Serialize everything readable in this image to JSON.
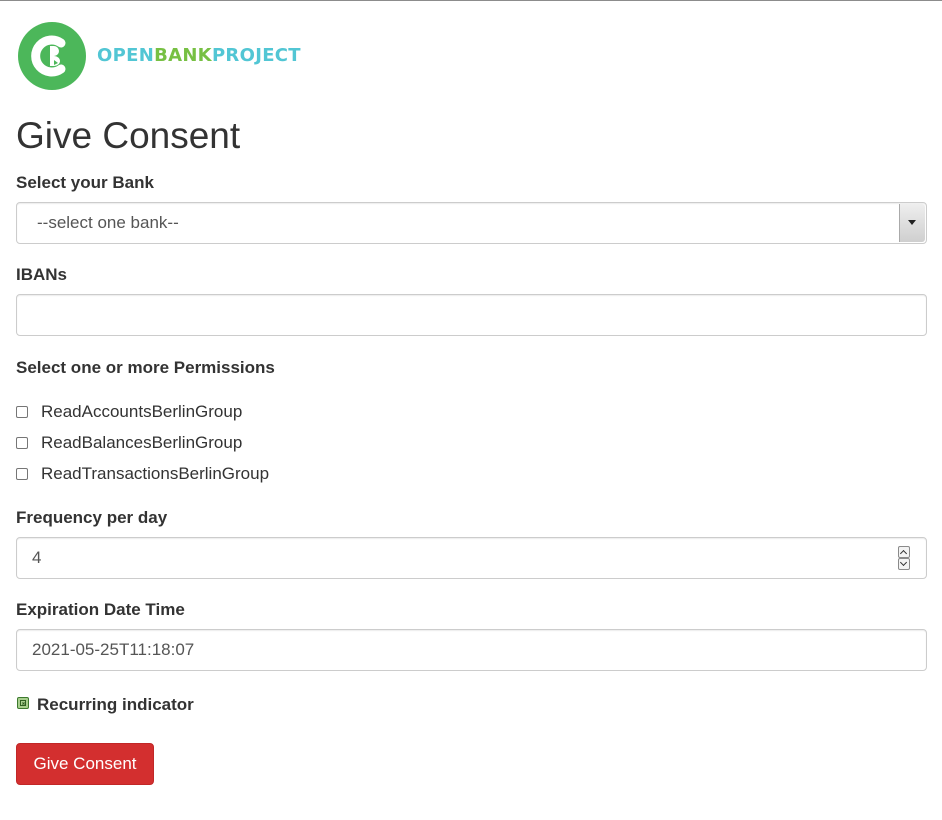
{
  "logo": {
    "icon": "open-bank-project-logo",
    "brand_part1": "OPEN",
    "brand_part2": "BANK",
    "brand_part3": "PROJECT",
    "colors": {
      "green": "#4cb75a",
      "teal": "#52c6d4",
      "lime": "#77c043"
    }
  },
  "page": {
    "title": "Give Consent"
  },
  "bank": {
    "label": "Select your Bank",
    "selected": "--select one bank--"
  },
  "ibans": {
    "label": "IBANs",
    "value": ""
  },
  "permissions": {
    "label": "Select one or more Permissions",
    "items": [
      {
        "label": "ReadAccountsBerlinGroup",
        "checked": false
      },
      {
        "label": "ReadBalancesBerlinGroup",
        "checked": false
      },
      {
        "label": "ReadTransactionsBerlinGroup",
        "checked": false
      }
    ]
  },
  "frequency": {
    "label": "Frequency per day",
    "value": "4"
  },
  "expiration": {
    "label": "Expiration Date Time",
    "value": "2021-05-25T11:18:07"
  },
  "recurring": {
    "label": "Recurring indicator",
    "checked": true
  },
  "submit": {
    "label": "Give Consent",
    "color": "#d32f2f"
  }
}
